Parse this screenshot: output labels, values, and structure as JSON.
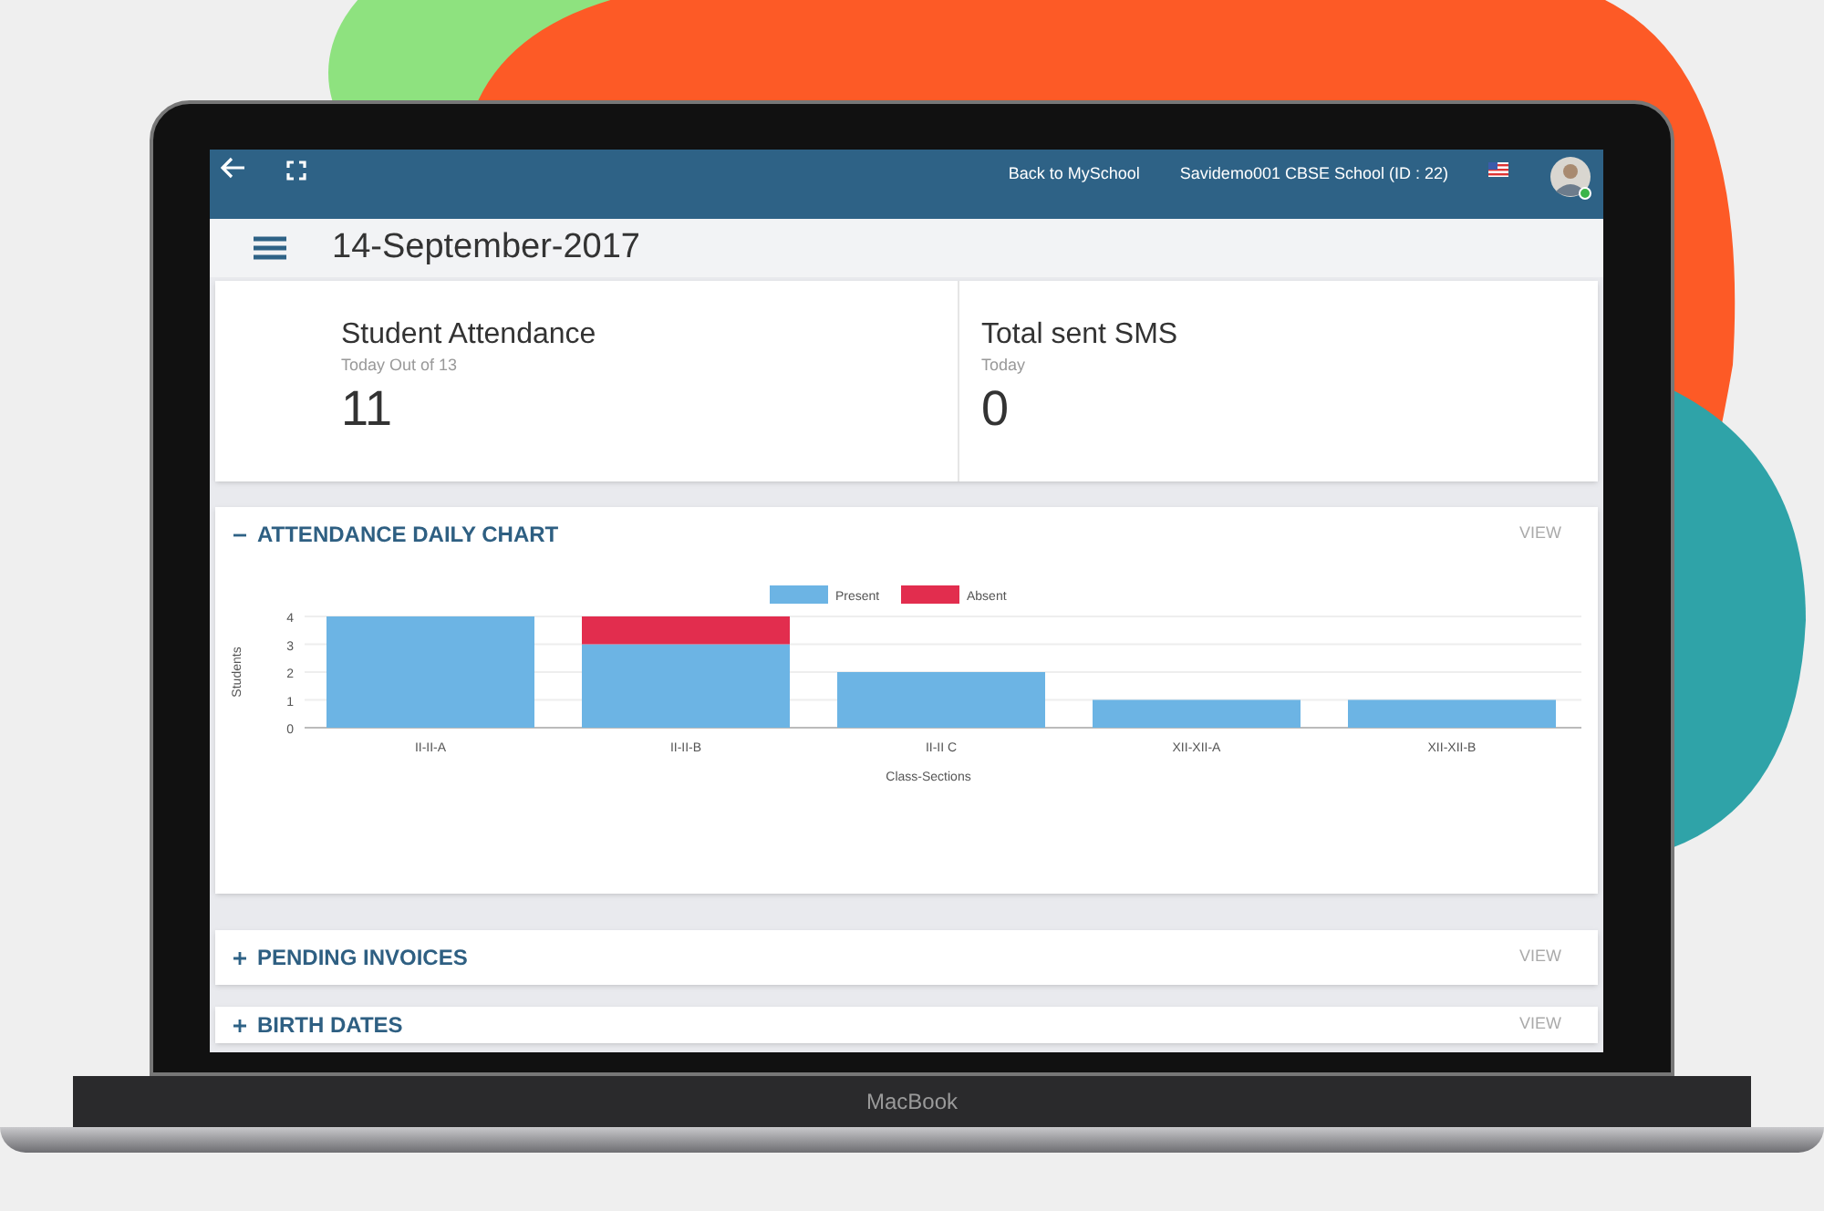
{
  "topbar": {
    "links": [
      "Back to MySchool",
      "Savidemo001 CBSE School (ID : 22)"
    ]
  },
  "date": "14-September-2017",
  "stats": [
    {
      "title": "Student Attendance",
      "subtitle": "Today Out of 13",
      "value": "11"
    },
    {
      "title": "Total sent SMS",
      "subtitle": "Today",
      "value": "0"
    }
  ],
  "panels": [
    {
      "title": "ATTENDANCE DAILY CHART",
      "expanded": true,
      "action": "VIEW",
      "chart_data": {
        "type": "bar",
        "stacked": true,
        "grid": true,
        "legend": true,
        "xlabel": "Class-Sections",
        "ylabel": "Students",
        "categories": [
          "II-II-A",
          "II-II-B",
          "II-II C",
          "XII-XII-A",
          "XII-XII-B"
        ],
        "ylim": [
          0,
          4
        ],
        "yticks": [
          0,
          1,
          2,
          3,
          4
        ],
        "series": [
          {
            "name": "Present",
            "color": "#6cb4e4",
            "values": [
              4,
              3,
              2,
              1,
              1
            ]
          },
          {
            "name": "Absent",
            "color": "#e22d4e",
            "values": [
              0,
              1,
              0,
              0,
              0
            ]
          }
        ]
      }
    },
    {
      "title": "PENDING INVOICES",
      "expanded": false,
      "action": "VIEW"
    },
    {
      "title": "BIRTH DATES",
      "expanded": false,
      "action": "VIEW"
    }
  ],
  "device_label": "MacBook"
}
